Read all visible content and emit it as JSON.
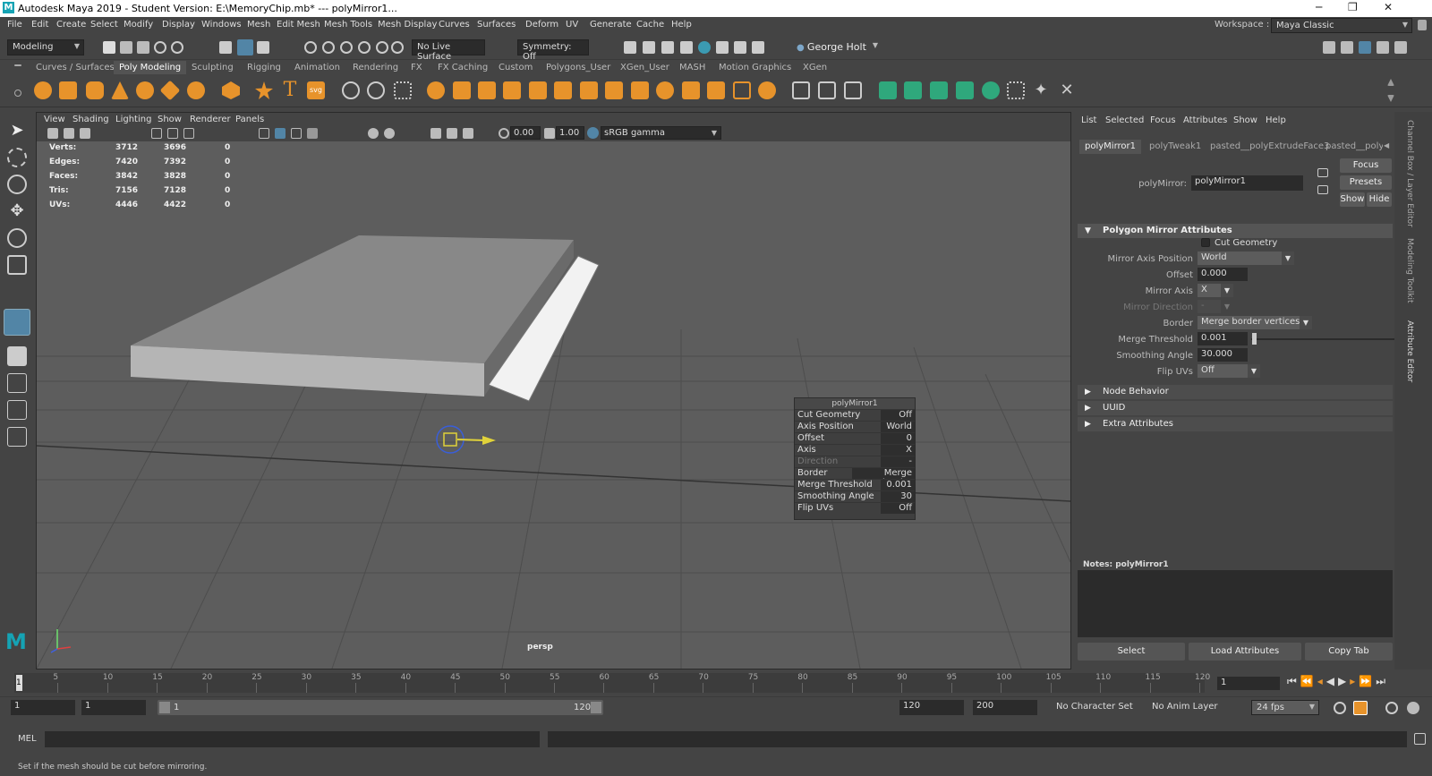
{
  "titlebar": {
    "title": "Autodesk Maya 2019 - Student Version: E:\\MemoryChip.mb*  ---  polyMirror1...",
    "min": "─",
    "max": "❐",
    "close": "✕"
  },
  "menu": [
    "File",
    "Edit",
    "Create",
    "Select",
    "Modify",
    "Display",
    "Windows",
    "Mesh",
    "Edit Mesh",
    "Mesh Tools",
    "Mesh Display",
    "Curves",
    "Surfaces",
    "Deform",
    "UV",
    "Generate",
    "Cache",
    "Help"
  ],
  "workspace": {
    "label": "Workspace :",
    "value": "Maya Classic"
  },
  "statusline": {
    "mode": "Modeling",
    "live_surface": "No Live Surface",
    "symmetry": "Symmetry: Off",
    "user": "George Holt"
  },
  "shelf_tabs": [
    "Curves / Surfaces",
    "Poly Modeling",
    "Sculpting",
    "Rigging",
    "Animation",
    "Rendering",
    "FX",
    "FX Caching",
    "Custom",
    "Polygons_User",
    "XGen_User",
    "MASH",
    "Motion Graphics",
    "XGen"
  ],
  "shelf_active": "Poly Modeling",
  "shelf_text_icons": {
    "text": "T",
    "svg": "svg"
  },
  "viewport": {
    "menu": [
      "View",
      "Shading",
      "Lighting",
      "Show",
      "Renderer",
      "Panels"
    ],
    "exposure": "0.00",
    "gamma": "1.00",
    "colorspace": "sRGB gamma",
    "camera": "persp",
    "stats": [
      {
        "label": "Verts:",
        "a": "3712",
        "b": "3696",
        "c": "0"
      },
      {
        "label": "Edges:",
        "a": "7420",
        "b": "7392",
        "c": "0"
      },
      {
        "label": "Faces:",
        "a": "3842",
        "b": "3828",
        "c": "0"
      },
      {
        "label": "Tris:",
        "a": "7156",
        "b": "7128",
        "c": "0"
      },
      {
        "label": "UVs:",
        "a": "4446",
        "b": "4422",
        "c": "0"
      }
    ]
  },
  "channel_box": {
    "title": "polyMirror1",
    "rows": [
      {
        "label": "Cut Geometry",
        "value": "Off"
      },
      {
        "label": "Axis Position",
        "value": "World"
      },
      {
        "label": "Offset",
        "value": "0"
      },
      {
        "label": "Axis",
        "value": "X"
      },
      {
        "label": "Direction",
        "value": "-"
      },
      {
        "label": "Border",
        "value": "Merge border"
      },
      {
        "label": "Merge Threshold",
        "value": "0.001"
      },
      {
        "label": "Smoothing Angle",
        "value": "30"
      },
      {
        "label": "Flip UVs",
        "value": "Off"
      }
    ]
  },
  "attr_editor": {
    "menu": [
      "List",
      "Selected",
      "Focus",
      "Attributes",
      "Show",
      "Help"
    ],
    "tabs": [
      "polyMirror1",
      "polyTweak1",
      "pasted__polyExtrudeFace3",
      "pasted__polyBe"
    ],
    "node_label": "polyMirror:",
    "node_value": "polyMirror1",
    "buttons": {
      "focus": "Focus",
      "presets": "Presets",
      "show": "Show",
      "hide": "Hide"
    },
    "section_main": "Polygon Mirror Attributes",
    "cut_geometry": "Cut Geometry",
    "fields": {
      "mirror_axis_position": {
        "label": "Mirror Axis Position",
        "value": "World"
      },
      "offset": {
        "label": "Offset",
        "value": "0.000"
      },
      "mirror_axis": {
        "label": "Mirror Axis",
        "value": "X"
      },
      "mirror_direction": {
        "label": "Mirror Direction",
        "value": "-"
      },
      "border": {
        "label": "Border",
        "value": "Merge border vertices"
      },
      "merge_threshold": {
        "label": "Merge Threshold",
        "value": "0.001"
      },
      "smoothing_angle": {
        "label": "Smoothing Angle",
        "value": "30.000"
      },
      "flip_uvs": {
        "label": "Flip UVs",
        "value": "Off"
      }
    },
    "sections": [
      "Node Behavior",
      "UUID",
      "Extra Attributes"
    ],
    "notes": "Notes:  polyMirror1",
    "bottom_buttons": [
      "Select",
      "Load Attributes",
      "Copy Tab"
    ]
  },
  "side_tabs": [
    "Channel Box / Layer Editor",
    "Modeling Toolkit",
    "Attribute Editor"
  ],
  "timeline": {
    "ticks": [
      "5",
      "10",
      "15",
      "20",
      "25",
      "30",
      "35",
      "40",
      "45",
      "50",
      "55",
      "60",
      "65",
      "70",
      "75",
      "80",
      "85",
      "90",
      "95",
      "100",
      "105",
      "110",
      "115",
      "120"
    ],
    "current": "1",
    "current_field": "1"
  },
  "range": {
    "start": "1",
    "start2": "1",
    "slider_start": "1",
    "slider_end": "120",
    "end": "120",
    "end2": "200",
    "char_set": "No Character Set",
    "anim_layer": "No Anim Layer",
    "fps": "24 fps"
  },
  "mel": {
    "label": "MEL"
  },
  "help": "Set if the mesh should be cut before mirroring.",
  "colors": {
    "accent": "#5285a6",
    "maya_teal": "#15a3b4",
    "shelf_orange": "#e7932b",
    "shelf_green": "#2fa87c"
  }
}
